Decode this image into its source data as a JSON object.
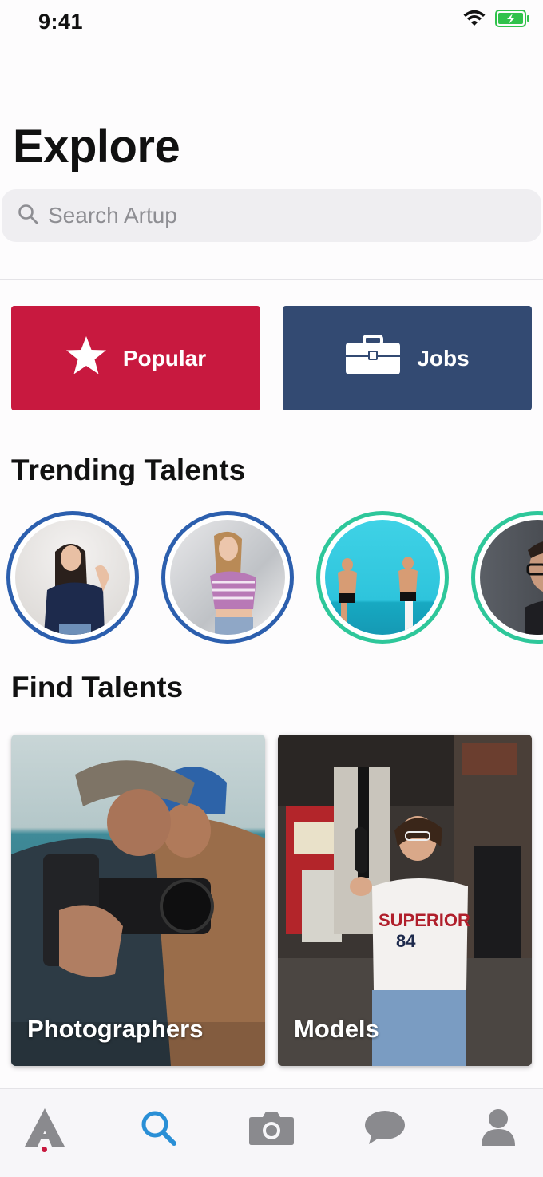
{
  "status_bar": {
    "time": "9:41"
  },
  "header": {
    "title": "Explore"
  },
  "search": {
    "placeholder": "Search Artup"
  },
  "categories": [
    {
      "label": "Popular",
      "icon": "star-icon",
      "color": "#c8193f"
    },
    {
      "label": "Jobs",
      "icon": "briefcase-icon",
      "color": "#334a72"
    }
  ],
  "trending": {
    "title": "Trending Talents",
    "avatars": [
      {
        "ring": "#2c5fae"
      },
      {
        "ring": "#2c5fae"
      },
      {
        "ring": "#2ec79a"
      },
      {
        "ring": "#2ec79a"
      }
    ]
  },
  "find_talents": {
    "title": "Find Talents",
    "cards": [
      {
        "label": "Photographers"
      },
      {
        "label": "Models"
      }
    ]
  },
  "tab_bar": {
    "items": [
      "home-icon",
      "search-icon",
      "camera-icon",
      "chat-icon",
      "profile-icon"
    ],
    "active_index": 1,
    "active_color": "#2a8fd6"
  }
}
